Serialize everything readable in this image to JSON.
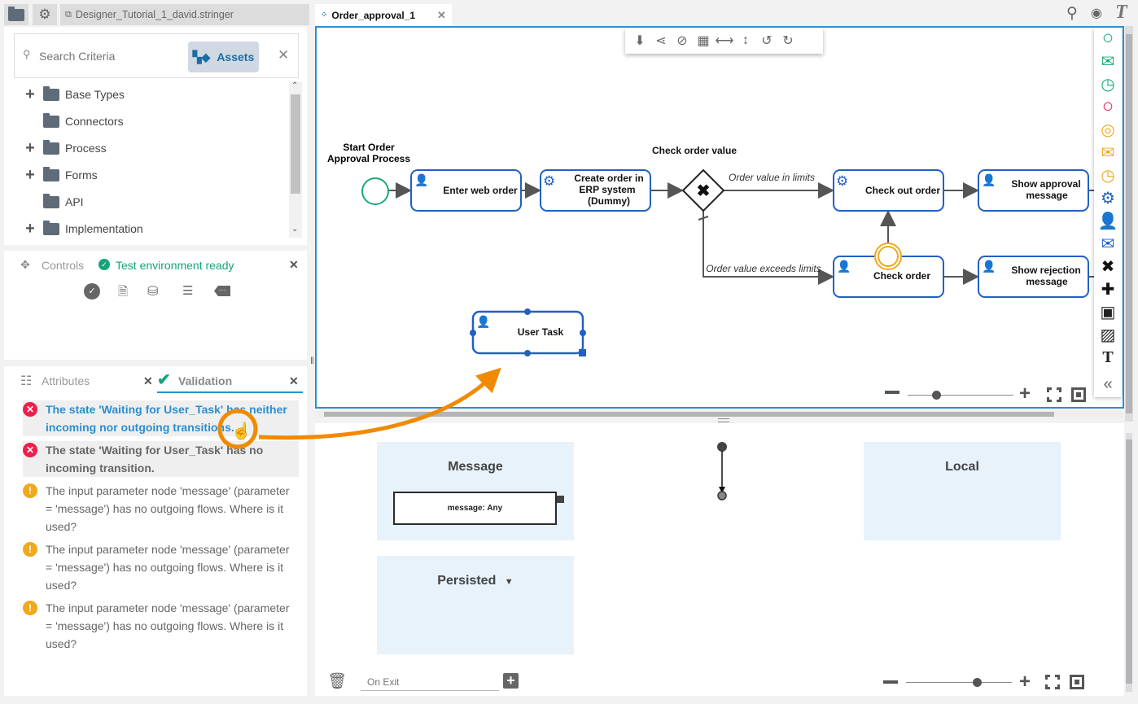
{
  "project_tab": {
    "label": "Designer_Tutorial_1_david.stringer"
  },
  "search": {
    "placeholder": "Search Criteria",
    "assets_label": "Assets"
  },
  "tree": [
    {
      "label": "Base Types",
      "expandable": true
    },
    {
      "label": "Connectors",
      "expandable": false
    },
    {
      "label": "Process",
      "expandable": true
    },
    {
      "label": "Forms",
      "expandable": true
    },
    {
      "label": "API",
      "expandable": false
    },
    {
      "label": "Implementation",
      "expandable": true
    }
  ],
  "controls": {
    "title": "Controls",
    "status": "Test environment ready",
    "status_color": "#14a57a"
  },
  "tabs": {
    "attributes": "Attributes",
    "validation": "Validation"
  },
  "validation": [
    {
      "level": "error",
      "text": "The state 'Waiting for User_Task' has neither incoming nor outgoing transitions.",
      "highlighted": true
    },
    {
      "level": "error",
      "text": "The state 'Waiting for User_Task' has no incoming transition."
    },
    {
      "level": "warning",
      "text": "The input parameter node 'message' (parameter = 'message') has no outgoing flows. Where is it used?"
    },
    {
      "level": "warning",
      "text": "The input parameter node 'message' (parameter = 'message') has no outgoing flows. Where is it used?"
    },
    {
      "level": "warning",
      "text": "The input parameter node 'message' (parameter = 'message') has no outgoing flows. Where is it used?"
    }
  ],
  "editor": {
    "tab": "Order_approval_1"
  },
  "diagram": {
    "start_label_1": "Start Order",
    "start_label_2": "Approval Process",
    "gateway_label": "Check order value",
    "enter_web_order": "Enter web order",
    "create_order_1": "Create order in",
    "create_order_2": "ERP system",
    "create_order_3": "(Dummy)",
    "check_out_order": "Check out order",
    "approval_1": "Show approval",
    "approval_2": "message",
    "check_order": "Check order",
    "rejection_1": "Show rejection",
    "rejection_2": "message",
    "flow_in_limits": "Order value in limits",
    "flow_exceeds": "Order value exceeds limits",
    "user_task": "User Task"
  },
  "lower": {
    "message_lane": "Message",
    "message_field": "message: Any",
    "local_lane": "Local",
    "persisted_lane": "Persisted",
    "on_exit_placeholder": "On Exit"
  },
  "colors": {
    "accent": "#2a8fd0",
    "task_border": "#2260c4",
    "annotation": "#f08a00",
    "error": "#ef1e4b",
    "warning": "#f0a81c"
  }
}
